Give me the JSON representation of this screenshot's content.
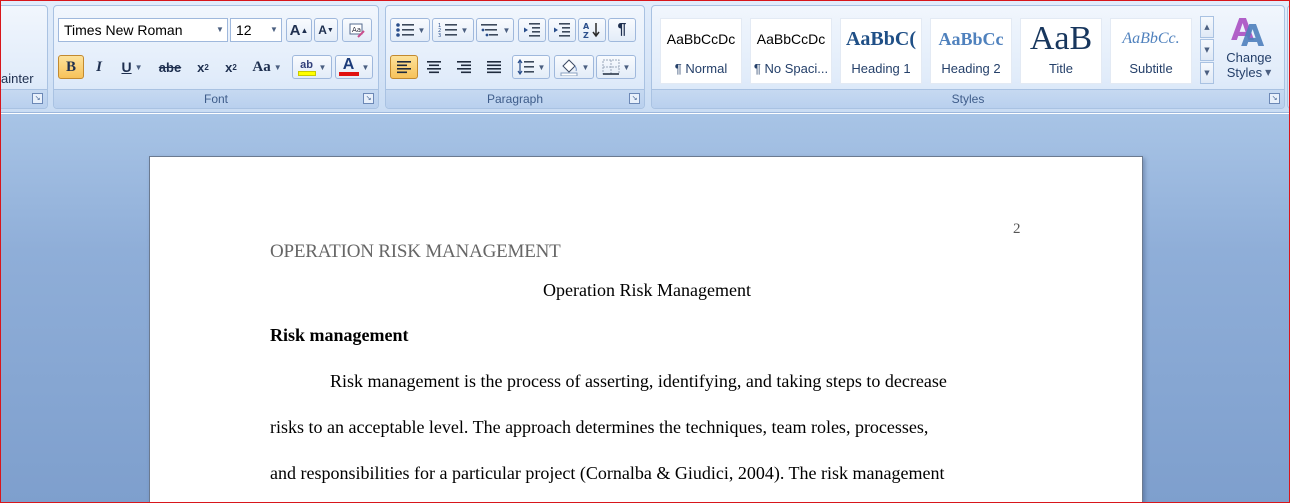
{
  "clipboard": {
    "format_painter_label": "ainter"
  },
  "font": {
    "group_label": "Font",
    "font_name": "Times New Roman",
    "font_size": "12",
    "grow_label": "A",
    "shrink_label": "A",
    "bold_label": "B",
    "italic_label": "I",
    "underline_label": "U",
    "strike_label": "abe",
    "subscript_label": "x",
    "superscript_label": "x",
    "change_case_label": "Aa",
    "highlight_label": "ab",
    "font_color_label": "A"
  },
  "paragraph": {
    "group_label": "Paragraph",
    "pilcrow_label": "¶"
  },
  "styles": {
    "group_label": "Styles",
    "tiles": [
      {
        "sample": "AaBbCcDc",
        "name": "¶ Normal"
      },
      {
        "sample": "AaBbCcDc",
        "name": "¶ No Spaci..."
      },
      {
        "sample": "AaBbC(",
        "name": "Heading 1"
      },
      {
        "sample": "AaBbCc",
        "name": "Heading 2"
      },
      {
        "sample": "AaB",
        "name": "Title"
      },
      {
        "sample": "AaBbCc.",
        "name": "Subtitle"
      }
    ],
    "change_styles_line1": "Change",
    "change_styles_line2": "Styles"
  },
  "document": {
    "page_number": "2",
    "running_head": "OPERATION RISK MANAGEMENT",
    "title": "Operation Risk Management",
    "heading": "Risk management",
    "lines": [
      "Risk management is the process of asserting, identifying, and taking steps to decrease",
      "risks to an acceptable level. The approach determines the techniques, team roles, processes,",
      "and responsibilities for a particular project (Cornalba & Giudici, 2004). The risk management"
    ]
  },
  "colors": {
    "accent": "#f7c25a",
    "frame": "#d8161b",
    "workspace": "#8faed8"
  }
}
